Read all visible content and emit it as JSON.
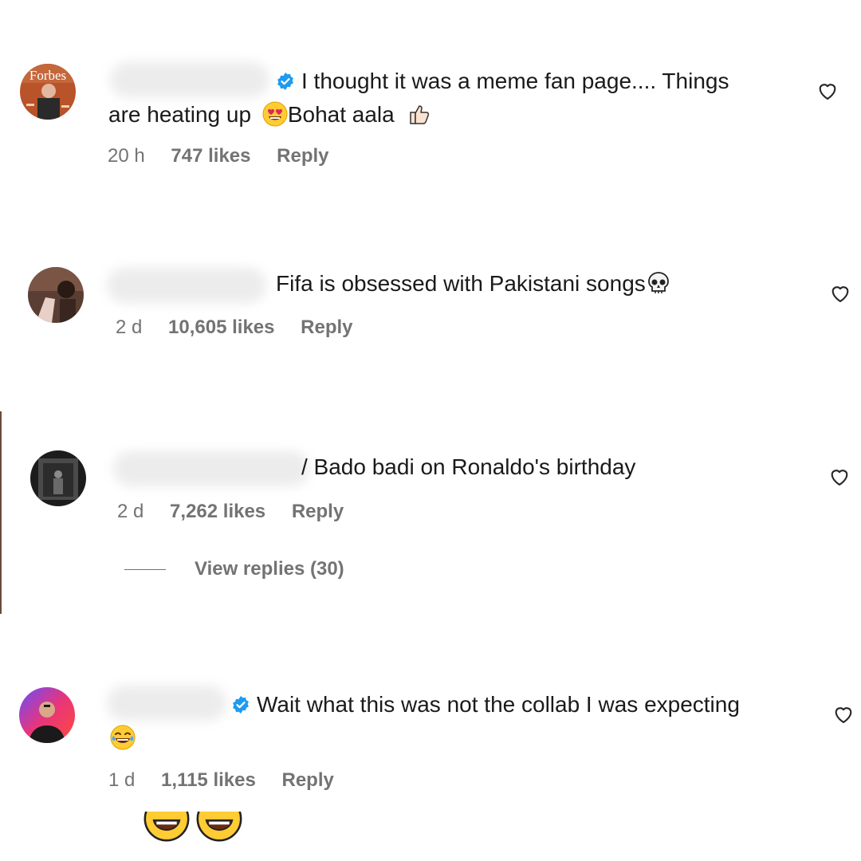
{
  "comments": [
    {
      "text_line1": "I thought it was a meme fan page.... Things",
      "text_line2_a": "are heating up",
      "text_line2_b": "Bohat aala",
      "time": "20 h",
      "likes": "747 likes",
      "reply": "Reply",
      "avatar_text": "Forbes",
      "verified": true
    },
    {
      "text_line1": "Fifa is obsessed with Pakistani songs",
      "time": "2 d",
      "likes": "10,605 likes",
      "reply": "Reply",
      "verified": false
    },
    {
      "text_line1": "/ Bado badi on Ronaldo's birthday",
      "time": "2 d",
      "likes": "7,262 likes",
      "reply": "Reply",
      "verified": false,
      "view_replies": "View replies (30)"
    },
    {
      "text_line1": "Wait what this was not the collab I was expecting",
      "time": "1 d",
      "likes": "1,115 likes",
      "reply": "Reply",
      "verified": true
    }
  ],
  "icons": {
    "verified": "verified-badge-icon",
    "heart": "heart-outline-icon",
    "heart_eyes": "heart-eyes-emoji",
    "thumbs_up": "thumbs-up-emoji",
    "skull": "skull-emoji",
    "laughing": "tears-of-joy-emoji"
  },
  "colors": {
    "verified": "#1d9bf0",
    "meta_text": "#737373",
    "body_text": "#1a1a1a"
  }
}
